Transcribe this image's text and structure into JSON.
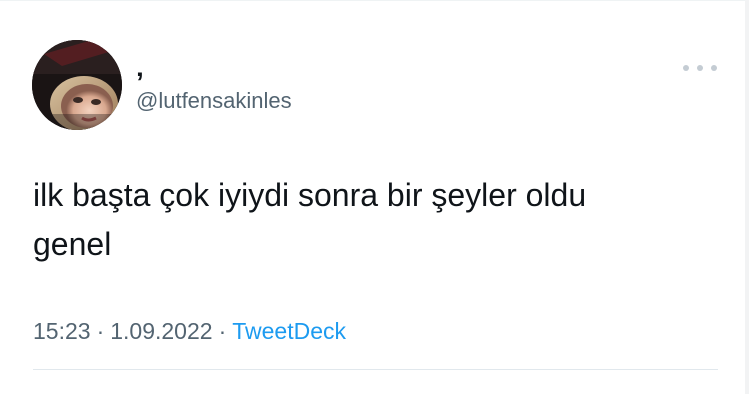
{
  "tweet": {
    "display_name": "‚",
    "handle": "@lutfensakinles",
    "text": "ilk başta çok iyiydi sonra bir şeyler oldu\ngenel",
    "time": "15:23",
    "separator": "·",
    "date": "1.09.2022",
    "source": "TweetDeck"
  },
  "icons": {
    "more": "more-horizontal-icon",
    "avatar": "profile-photo"
  },
  "colors": {
    "text": "#0f1419",
    "secondary": "#536471",
    "link": "#1d9bf0"
  }
}
